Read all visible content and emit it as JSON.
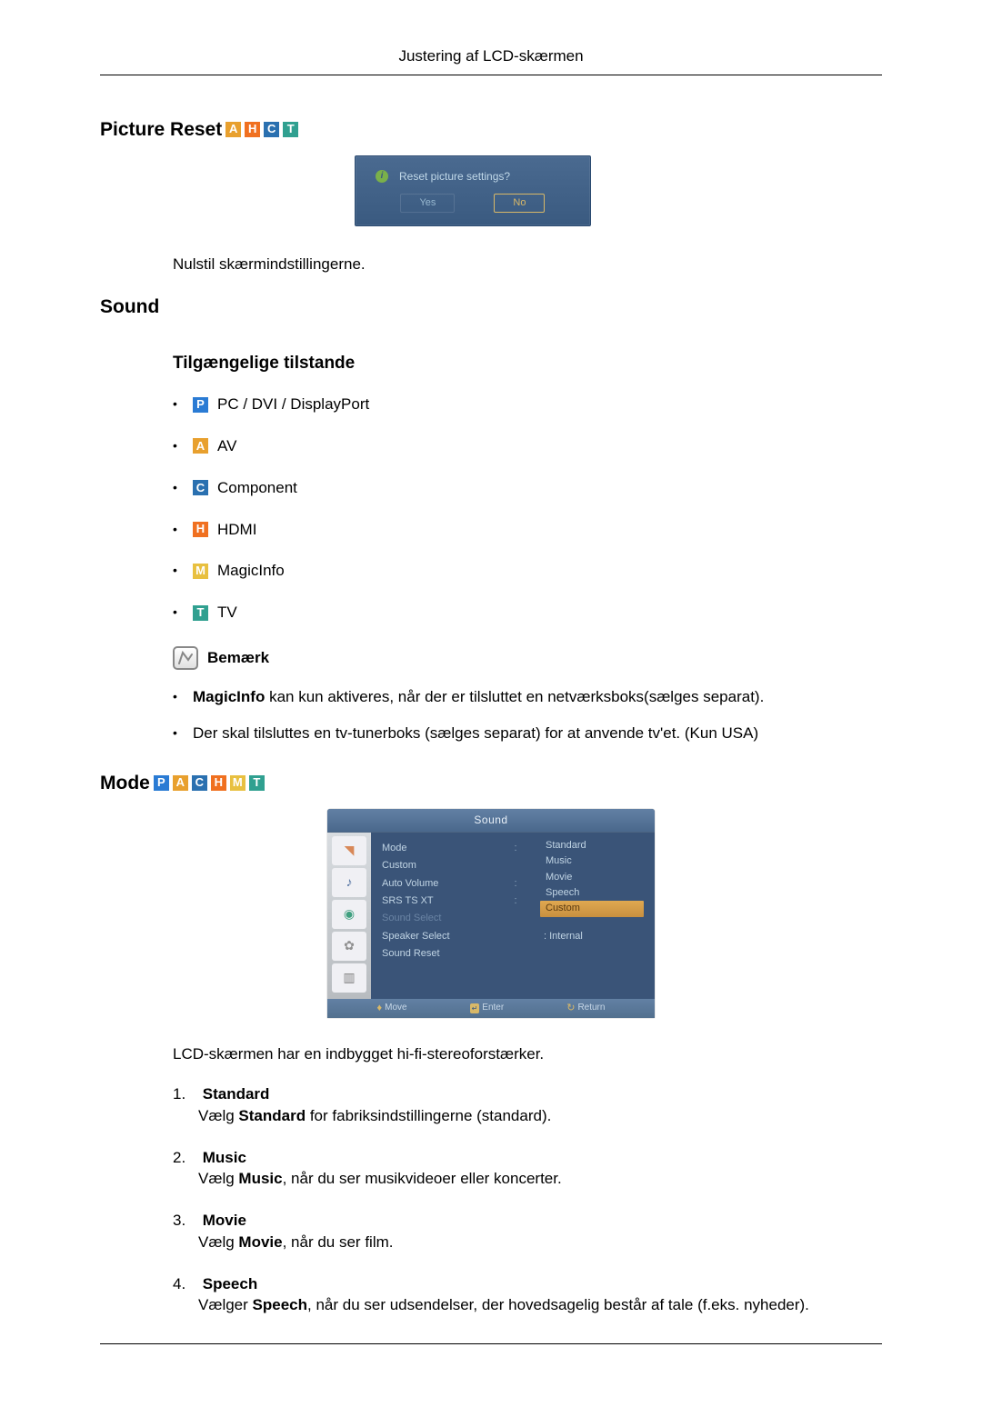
{
  "header": {
    "title": "Justering af LCD-skærmen"
  },
  "picture_reset": {
    "title": "Picture Reset",
    "badges": [
      "A",
      "H",
      "C",
      "T"
    ],
    "dialog": {
      "question": "Reset picture settings?",
      "yes": "Yes",
      "no": "No"
    },
    "desc": "Nulstil skærmindstillingerne."
  },
  "sound": {
    "title": "Sound",
    "sub_title": "Tilgængelige tilstande",
    "modes": [
      {
        "badge": "P",
        "badgeClass": "badge-P",
        "label": " PC / DVI / DisplayPort"
      },
      {
        "badge": "A",
        "badgeClass": "badge-A",
        "label": " AV"
      },
      {
        "badge": "C",
        "badgeClass": "badge-C",
        "label": " Component"
      },
      {
        "badge": "H",
        "badgeClass": "badge-H",
        "label": " HDMI"
      },
      {
        "badge": "M",
        "badgeClass": "badge-M",
        "label": " MagicInfo"
      },
      {
        "badge": "T",
        "badgeClass": "badge-T",
        "label": " TV"
      }
    ],
    "note_label": "Bemærk",
    "notes": [
      {
        "bold": "MagicInfo",
        "rest": " kan kun aktiveres, når der er tilsluttet en netværksboks(sælges separat)."
      },
      {
        "bold": "",
        "rest": "Der skal tilsluttes en tv-tunerboks (sælges separat) for at anvende tv'et. (Kun USA)"
      }
    ]
  },
  "mode_section": {
    "title": "Mode",
    "badges": [
      "P",
      "A",
      "C",
      "H",
      "M",
      "T"
    ],
    "menu": {
      "title": "Sound",
      "items": [
        {
          "label": "Mode",
          "value": "Standard"
        },
        {
          "label": "Custom",
          "value": "Music"
        },
        {
          "label": "Auto Volume",
          "value": "Movie"
        },
        {
          "label": "SRS TS XT",
          "value": "Speech"
        },
        {
          "label": "Sound Select",
          "value": "Custom",
          "dim": true,
          "highlight": true
        },
        {
          "label": "Speaker Select",
          "value": ": Internal"
        },
        {
          "label": "Sound Reset",
          "value": ""
        }
      ],
      "footer": {
        "move": "Move",
        "enter": "Enter",
        "return": "Return"
      }
    },
    "intro": "LCD-skærmen har en indbygget hi-fi-stereoforstærker.",
    "options": [
      {
        "title": "Standard",
        "pre": "Vælg ",
        "bold": "Standard",
        "post": " for fabriksindstillingerne (standard)."
      },
      {
        "title": "Music",
        "pre": "Vælg ",
        "bold": "Music",
        "post": ", når du ser musikvideoer eller koncerter."
      },
      {
        "title": "Movie",
        "pre": "Vælg ",
        "bold": "Movie",
        "post": ", når du ser film."
      },
      {
        "title": "Speech",
        "pre": "Vælger ",
        "bold": "Speech",
        "post": ", når du ser udsendelser, der hovedsagelig består af tale (f.eks. nyheder)."
      }
    ]
  }
}
